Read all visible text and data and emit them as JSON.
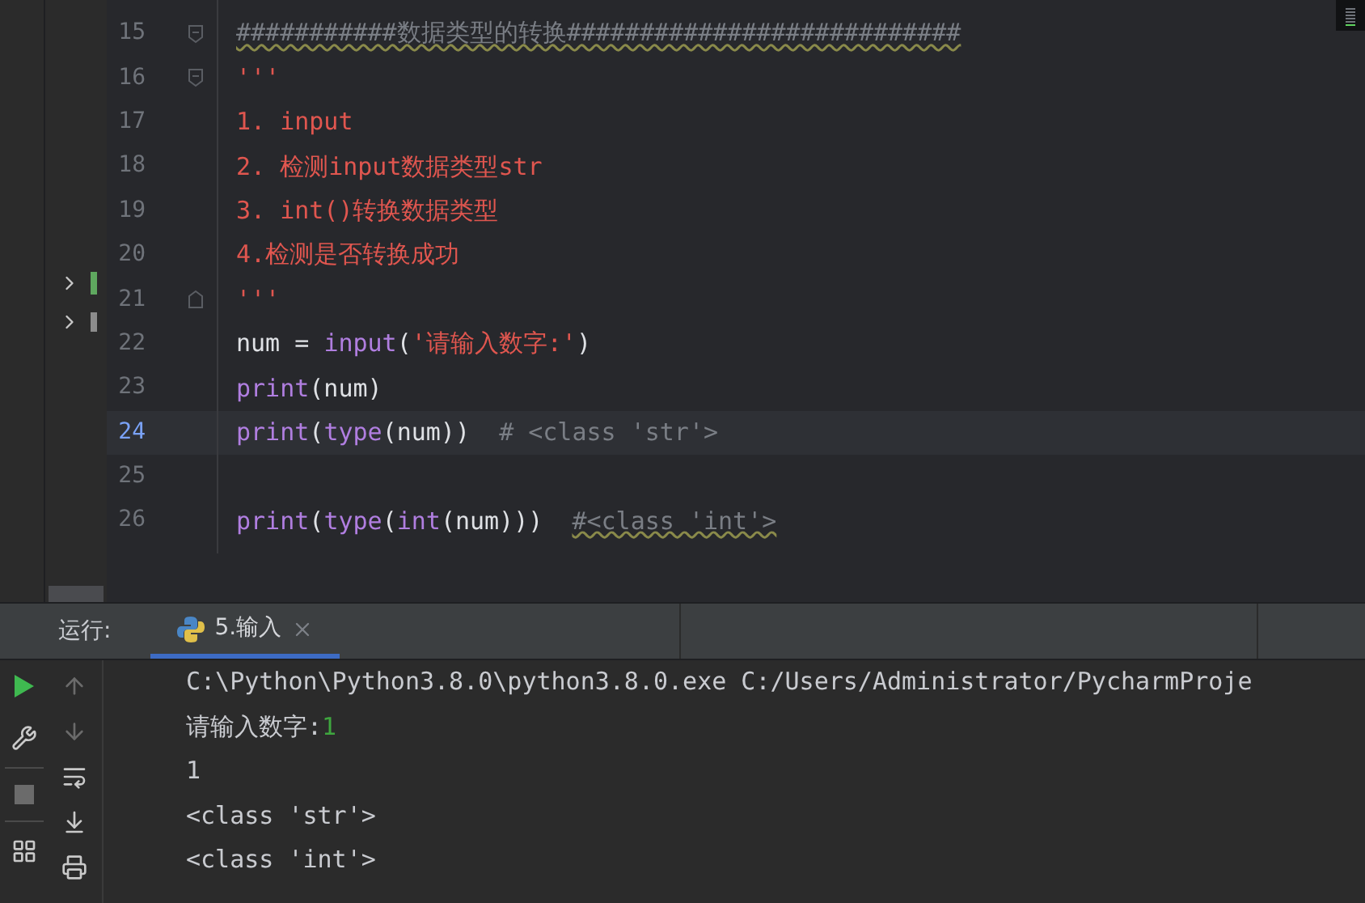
{
  "editor": {
    "lines": [
      {
        "number": "15",
        "current": false,
        "fold_open": true,
        "fold_close": false,
        "tokens": [
          {
            "text": "###########数据类型的转换###########################",
            "kind": "comment",
            "underlined": true
          }
        ]
      },
      {
        "number": "16",
        "current": false,
        "fold_open": true,
        "fold_close": false,
        "tokens": [
          {
            "text": "'''",
            "kind": "docstring",
            "underlined": false
          }
        ]
      },
      {
        "number": "17",
        "current": false,
        "fold_open": false,
        "fold_close": false,
        "tokens": [
          {
            "text": "1. input",
            "kind": "docstring",
            "underlined": false
          }
        ]
      },
      {
        "number": "18",
        "current": false,
        "fold_open": false,
        "fold_close": false,
        "tokens": [
          {
            "text": "2. 检测input数据类型str",
            "kind": "docstring",
            "underlined": false
          }
        ]
      },
      {
        "number": "19",
        "current": false,
        "fold_open": false,
        "fold_close": false,
        "tokens": [
          {
            "text": "3. int()转换数据类型",
            "kind": "docstring",
            "underlined": false
          }
        ]
      },
      {
        "number": "20",
        "current": false,
        "fold_open": false,
        "fold_close": false,
        "tokens": [
          {
            "text": "4.检测是否转换成功",
            "kind": "docstring",
            "underlined": false
          }
        ]
      },
      {
        "number": "21",
        "current": false,
        "fold_open": false,
        "fold_close": true,
        "tokens": [
          {
            "text": "'''",
            "kind": "docstring",
            "underlined": false
          }
        ]
      },
      {
        "number": "22",
        "current": false,
        "fold_open": false,
        "fold_close": false,
        "tokens": [
          {
            "text": "num = ",
            "kind": "plain",
            "underlined": false
          },
          {
            "text": "input",
            "kind": "builtin",
            "underlined": false
          },
          {
            "text": "(",
            "kind": "plain",
            "underlined": false
          },
          {
            "text": "'请输入数字:'",
            "kind": "string",
            "underlined": false
          },
          {
            "text": ")",
            "kind": "plain",
            "underlined": false
          }
        ]
      },
      {
        "number": "23",
        "current": false,
        "fold_open": false,
        "fold_close": false,
        "tokens": [
          {
            "text": "print",
            "kind": "builtin",
            "underlined": false
          },
          {
            "text": "(num)",
            "kind": "plain",
            "underlined": false
          }
        ]
      },
      {
        "number": "24",
        "current": true,
        "fold_open": false,
        "fold_close": false,
        "tokens": [
          {
            "text": "print",
            "kind": "builtin",
            "underlined": false
          },
          {
            "text": "(",
            "kind": "plain",
            "underlined": false
          },
          {
            "text": "type",
            "kind": "builtin",
            "underlined": false
          },
          {
            "text": "(num))  ",
            "kind": "plain",
            "underlined": false
          },
          {
            "text": "# <class 'str'>",
            "kind": "comment",
            "underlined": false
          }
        ]
      },
      {
        "number": "25",
        "current": false,
        "fold_open": false,
        "fold_close": false
      },
      {
        "number": "26",
        "current": false,
        "fold_open": false,
        "fold_close": false,
        "tokens": [
          {
            "text": "print",
            "kind": "builtin",
            "underlined": false
          },
          {
            "text": "(",
            "kind": "plain",
            "underlined": false
          },
          {
            "text": "type",
            "kind": "builtin",
            "underlined": false
          },
          {
            "text": "(",
            "kind": "plain",
            "underlined": false
          },
          {
            "text": "int",
            "kind": "builtin",
            "underlined": false
          },
          {
            "text": "(num)))  ",
            "kind": "plain",
            "underlined": false
          },
          {
            "text": "#<class 'int'>",
            "kind": "comment",
            "underlined": true
          }
        ]
      }
    ]
  },
  "run_panel": {
    "label": "运行:",
    "tabs": [
      {
        "label": "5.输入",
        "selected": true
      }
    ],
    "console": [
      {
        "segments": [
          {
            "text": "C:\\Python\\Python3.8.0\\python3.8.0.exe C:/Users/Administrator/PycharmProje",
            "kind": "output"
          }
        ]
      },
      {
        "segments": [
          {
            "text": "请输入数字:",
            "kind": "output"
          },
          {
            "text": "1",
            "kind": "input"
          }
        ]
      },
      {
        "segments": [
          {
            "text": "1",
            "kind": "output"
          }
        ]
      },
      {
        "segments": [
          {
            "text": "<class 'str'>",
            "kind": "output"
          }
        ]
      },
      {
        "segments": [
          {
            "text": "<class 'int'>",
            "kind": "output"
          }
        ]
      }
    ]
  }
}
